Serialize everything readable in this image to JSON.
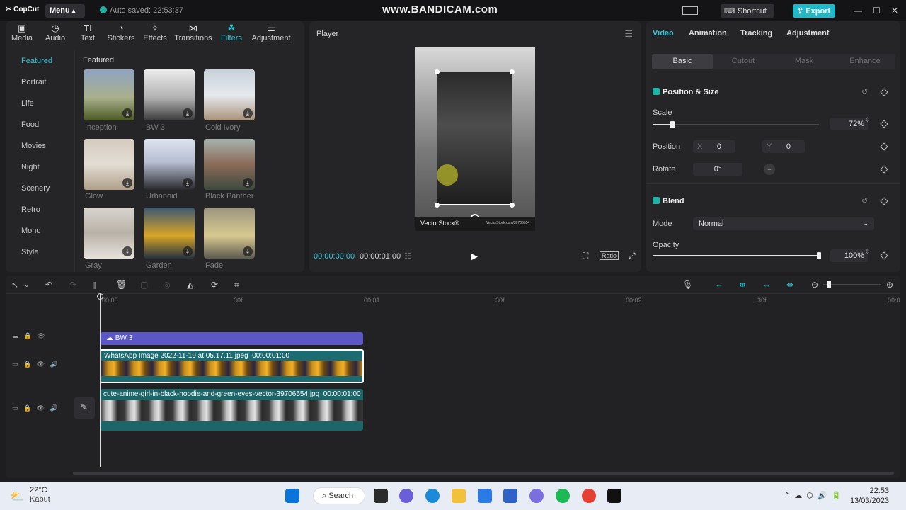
{
  "titlebar": {
    "app_name": "CopCut",
    "menu_label": "Menu",
    "autosave": "Auto saved: 22:53:37",
    "watermark": "www.BANDICAM.com",
    "shortcut_label": "Shortcut",
    "export_label": "Export"
  },
  "media_tabs": [
    {
      "label": "Media",
      "icon": "media-icon"
    },
    {
      "label": "Audio",
      "icon": "audio-icon"
    },
    {
      "label": "Text",
      "icon": "text-icon"
    },
    {
      "label": "Stickers",
      "icon": "stickers-icon"
    },
    {
      "label": "Effects",
      "icon": "effects-icon"
    },
    {
      "label": "Transitions",
      "icon": "transitions-icon"
    },
    {
      "label": "Filters",
      "icon": "filters-icon"
    },
    {
      "label": "Adjustment",
      "icon": "adjustment-icon"
    }
  ],
  "active_tab": "Filters",
  "categories": [
    "Featured",
    "Portrait",
    "Life",
    "Food",
    "Movies",
    "Night",
    "Scenery",
    "Retro",
    "Mono",
    "Style"
  ],
  "grid_title": "Featured",
  "filters": [
    {
      "label": "Inception",
      "color": "#6b7d4a"
    },
    {
      "label": "BW 3",
      "color": "#9a9a9a"
    },
    {
      "label": "Cold Ivory",
      "color": "#b8c3cc"
    },
    {
      "label": "Glow",
      "color": "#c9b9a8"
    },
    {
      "label": "Urbanoid",
      "color": "#c7ccd8"
    },
    {
      "label": "Black Panther",
      "color": "#7c8a7a"
    },
    {
      "label": "Gray",
      "color": "#b7b1a7"
    },
    {
      "label": "Garden",
      "color": "#5a7088"
    },
    {
      "label": "Fade",
      "color": "#8f8a76"
    }
  ],
  "player": {
    "title": "Player",
    "current_time": "00:00:00:00",
    "total_time": "00:00:01:00",
    "ratio_label": "Ratio",
    "watermark_text": "VectorStock®",
    "watermark_url": "VectorStock.com/39706554"
  },
  "properties": {
    "tabs": [
      "Video",
      "Animation",
      "Tracking",
      "Adjustment"
    ],
    "subtabs": [
      "Basic",
      "Cutout",
      "Mask",
      "Enhance"
    ],
    "position_size_title": "Position & Size",
    "scale_label": "Scale",
    "scale_value": "72%",
    "scale_fraction": 0.72,
    "position_label": "Position",
    "x_label": "X",
    "x_value": "0",
    "y_label": "Y",
    "y_value": "0",
    "rotate_label": "Rotate",
    "rotate_value": "0°",
    "blend_title": "Blend",
    "mode_label": "Mode",
    "mode_value": "Normal",
    "opacity_label": "Opacity",
    "opacity_value": "100%",
    "opacity_fraction": 1.0
  },
  "timeline": {
    "ruler_ticks": [
      "00:00",
      "30f",
      "00:01",
      "30f",
      "00:02",
      "30f",
      "00:0"
    ],
    "filter_clip": "BW 3",
    "video_clip_1": {
      "name": "WhatsApp Image 2022-11-19 at 05.17.11.jpeg",
      "duration": "00:00:01:00"
    },
    "video_clip_2": {
      "name": "cute-anime-girl-in-black-hoodie-and-green-eyes-vector-39706554.jpg",
      "duration": "00:00:01:00"
    }
  },
  "taskbar": {
    "temperature": "22°C",
    "weather": "Kabut",
    "search_label": "Search",
    "time": "22:53",
    "date": "13/03/2023"
  },
  "colors": {
    "accent": "#33c5d6",
    "filter_clip": "#5b58c6",
    "video_clip": "#1b6b70"
  }
}
